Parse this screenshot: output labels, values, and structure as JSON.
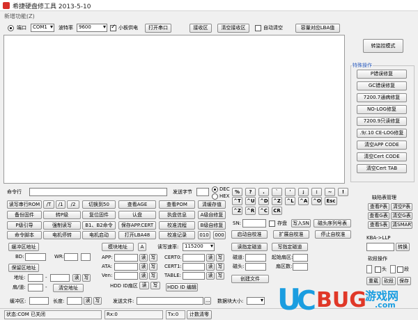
{
  "app": {
    "title": "希捷硬盘修工具 2013-5-10",
    "menu": "新增功能(Z)"
  },
  "port_bar": {
    "port_label": "端口",
    "port_value": "COM1",
    "baud_label": "波特率",
    "baud_value": "9600",
    "small_board_label": "小板供电",
    "open_port": "打开串口",
    "receive_area": "接收区",
    "clear_receive": "清空接收区",
    "auto_clear_label": "自动清空",
    "capacity_lba": "容量对应LBA值"
  },
  "right_panel": {
    "monitor_mode": "转监控模式",
    "special_ops_title": "特殊操作",
    "special_ops": [
      "P错误修复",
      "GC错误修复",
      "7200.7通病修复",
      "NO-LOG修复",
      "7200.9只读修复",
      ".9/.10 CE-LOG修复",
      "清空APP CODE",
      "清空Cert CODE",
      "清空Cert TAB"
    ]
  },
  "command": {
    "label": "命令行",
    "send_char_label": "发送字节",
    "dec": "DEC",
    "hex": "HEX"
  },
  "cmd_buttons": [
    [
      "读写串行ROM",
      "/T",
      "/1",
      "/2",
      "切换到50",
      "查看AGE",
      "查看POM",
      "清缓存值"
    ],
    [
      "备份固件",
      "转P级",
      "复位固件",
      "认盘",
      "执盘信息",
      "A级自修复"
    ],
    [
      "P级引导",
      "强制读写",
      "B1、B2命令",
      "保存APP.CERT",
      "校准流程",
      "B级自修复"
    ],
    [
      "命令脚本",
      "电机停转",
      "电机启动",
      "打开LBA48",
      "校准记录",
      "010",
      "000"
    ]
  ],
  "keypad": {
    "row1": [
      "%",
      "?",
      ".",
      "`",
      "'",
      ";",
      ":",
      "~",
      "!"
    ],
    "row2": [
      "^T",
      "^U",
      "^D",
      "^Z",
      "^L",
      "^A",
      "^O",
      "Esc"
    ],
    "row3": [
      "^Z",
      "^R",
      "^C",
      "CR"
    ]
  },
  "sn_row": {
    "sn_label": "SN:",
    "save_label": "存盘",
    "write_sn": "写入SN",
    "head_sn": "磁头序列号表"
  },
  "calib_row": {
    "start_calib": "启动自校准",
    "extend_calib": "扩展自校准",
    "stop_calib": "停止自校准"
  },
  "defect": {
    "title": "缺陷表管理",
    "buttons": [
      "查看P表",
      "清空P表",
      "查看G表",
      "清空G表",
      "查看S表",
      "清SMART"
    ],
    "kba_label": "KBA->LLP",
    "convert": "转换",
    "dir_title": "砍段操作",
    "head": "头",
    "segment": "段",
    "redo": "重载",
    "cut": "砍段",
    "save": "保存"
  },
  "buffer": {
    "buf_addr": "缓冲区地址",
    "bd_label": "BD:",
    "wr_label": "WR:",
    "save_addr": "保留区地址",
    "addr_label": "地址:",
    "read": "读",
    "write": "写",
    "cyl_track": "扇/道:",
    "clear_addr": "清空地址",
    "module_addr": "模块地址",
    "a_label": "A",
    "rw_speed_label": "读写速率:",
    "rw_speed": "115200",
    "app": "APP:",
    "ata": "ATA:",
    "ven": "Ven:",
    "cert0": "CERT0:",
    "cert1": "CERT1:",
    "table": "TABLE:",
    "hdd_id_sector": "HDD ID扇区",
    "hdd_id_edit": "HDD ID 编辑",
    "read_track": "读指定磁道",
    "write_track": "写指定磁道",
    "track_label": "磁道:",
    "start_sector": "起始扇区:",
    "head_label": "磁头:",
    "sector_count": "扇区数:",
    "create_file": "创建文件",
    "buf_label": "缓冲区:",
    "length_label": "长度:",
    "send_file_label": "发送文件:",
    "block_size_label": "数据块大小:",
    "browse": "..."
  },
  "status": {
    "state": "状态:COM 已关闭",
    "rx": "Rx:0",
    "tx": "Tx:0",
    "clear_count": "计数清零"
  },
  "watermark": {
    "u": "U",
    "c": "C",
    "bug": "BUG",
    "cn": "游戏网",
    "site": ".com"
  }
}
